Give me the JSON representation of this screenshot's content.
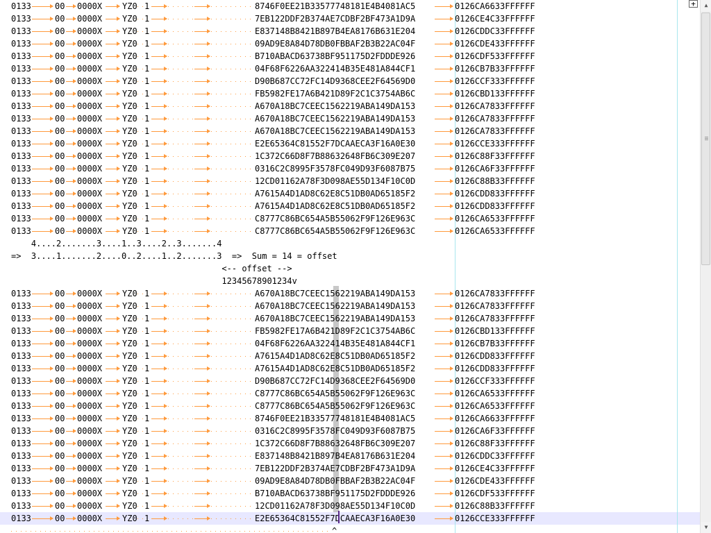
{
  "editor": {
    "prefix": {
      "c1": "0133",
      "c2": "00",
      "c3": "0000X",
      "c4": "YZ0",
      "c5": "1"
    },
    "top_rows": [
      {
        "hash": "8746F0EE21B33577748181E4B4081AC5",
        "code": "0126CA6633FFFFFF"
      },
      {
        "hash": "7EB122DDF2B374AE7CDBF2BF473A1D9A",
        "code": "0126CE4C33FFFFFF"
      },
      {
        "hash": "E837148B8421B897B4EA8176B631E204",
        "code": "0126CDDC33FFFFFF"
      },
      {
        "hash": "09AD9E8A84D78DB0FBBAF2B3B22AC04F",
        "code": "0126CDE433FFFFFF"
      },
      {
        "hash": "B710ABACD63738BF951175D2FDDDE926",
        "code": "0126CDF533FFFFFF"
      },
      {
        "hash": "04F68F6226AA322414B35E481A844CF1",
        "code": "0126CB7B33FFFFFF"
      },
      {
        "hash": "D90B687CC72FC14D9368CEE2F64569D0",
        "code": "0126CCF333FFFFFF"
      },
      {
        "hash": "FB5982FE17A6B421D89F2C1C3754AB6C",
        "code": "0126CBD133FFFFFF"
      },
      {
        "hash": "A670A18BC7CEEC1562219ABA149DA153",
        "code": "0126CA7833FFFFFF"
      },
      {
        "hash": "A670A18BC7CEEC1562219ABA149DA153",
        "code": "0126CA7833FFFFFF"
      },
      {
        "hash": "A670A18BC7CEEC1562219ABA149DA153",
        "code": "0126CA7833FFFFFF"
      },
      {
        "hash": "E2E65364C81552F7DCAAECA3F16A0E30",
        "code": "0126CCE333FFFFFF"
      },
      {
        "hash": "1C372C66D8F7B88632648FB6C309E207",
        "code": "0126C88F33FFFFFF"
      },
      {
        "hash": "0316C2C8995F3578FC049D93F6087B75",
        "code": "0126CA6F33FFFFFF"
      },
      {
        "hash": "12CD01162A78F3D098AE55D134F10C0D",
        "code": "0126C88B33FFFFFF"
      },
      {
        "hash": "A7615A4D1AD8C62E8C51DB0AD65185F2",
        "code": "0126CDD833FFFFFF"
      },
      {
        "hash": "A7615A4D1AD8C62E8C51DB0AD65185F2",
        "code": "0126CDD833FFFFFF"
      },
      {
        "hash": "C8777C86BC654A5B55062F9F126E963C",
        "code": "0126CA6533FFFFFF"
      },
      {
        "hash": "C8777C86BC654A5B55062F9F126E963C",
        "code": "0126CA6533FFFFFF"
      }
    ],
    "note_lines": [
      "    4....2.......3....1..3....2..3.......4",
      "=>  3....1.......2....0..2....1..2.......3  =>  Sum = 14 = offset",
      "                                          <-- offset -->",
      "                                          12345678901234v"
    ],
    "bottom_rows": [
      {
        "hash": "A670A18BC7CEEC1562219ABA149DA153",
        "code": "0126CA7833FFFFFF"
      },
      {
        "hash": "A670A18BC7CEEC1562219ABA149DA153",
        "code": "0126CA7833FFFFFF"
      },
      {
        "hash": "A670A18BC7CEEC1562219ABA149DA153",
        "code": "0126CA7833FFFFFF"
      },
      {
        "hash": "FB5982FE17A6B421D89F2C1C3754AB6C",
        "code": "0126CBD133FFFFFF"
      },
      {
        "hash": "04F68F6226AA322414B35E481A844CF1",
        "code": "0126CB7B33FFFFFF"
      },
      {
        "hash": "A7615A4D1AD8C62E8C51DB0AD65185F2",
        "code": "0126CDD833FFFFFF"
      },
      {
        "hash": "A7615A4D1AD8C62E8C51DB0AD65185F2",
        "code": "0126CDD833FFFFFF"
      },
      {
        "hash": "D90B687CC72FC14D9368CEE2F64569D0",
        "code": "0126CCF333FFFFFF"
      },
      {
        "hash": "C8777C86BC654A5B55062F9F126E963C",
        "code": "0126CA6533FFFFFF"
      },
      {
        "hash": "C8777C86BC654A5B55062F9F126E963C",
        "code": "0126CA6533FFFFFF"
      },
      {
        "hash": "8746F0EE21B33577748181E4B4081AC5",
        "code": "0126CA6633FFFFFF"
      },
      {
        "hash": "0316C2C8995F3578FC049D93F6087B75",
        "code": "0126CA6F33FFFFFF"
      },
      {
        "hash": "1C372C66D8F7B88632648FB6C309E207",
        "code": "0126C88F33FFFFFF"
      },
      {
        "hash": "E837148B8421B897B4EA8176B631E204",
        "code": "0126CDDC33FFFFFF"
      },
      {
        "hash": "7EB122DDF2B374AE7CDBF2BF473A1D9A",
        "code": "0126CE4C33FFFFFF"
      },
      {
        "hash": "09AD9E8A84D78DB0FBBAF2B3B22AC04F",
        "code": "0126CDE433FFFFFF"
      },
      {
        "hash": "B710ABACD63738BF951175D2FDDDE926",
        "code": "0126CDF533FFFFFF"
      },
      {
        "hash": "12CD01162A78F3D098AE55D134F10C0D",
        "code": "0126C88B33FFFFFF"
      },
      {
        "hash": "E2E65364C81552F7DCAAECA3F16A0E30",
        "code": "0126CCE333FFFFFF"
      }
    ],
    "caret_marker": "^",
    "expand_label": "+",
    "colors": {
      "whitespace": "#ff9a3c",
      "guide": "#a8e6ee",
      "current_line": "#e8e8ff",
      "column_highlight": "#c8c8c8"
    }
  },
  "scrollbar": {
    "up_icon": "triangle-up-icon",
    "down_icon": "triangle-down-icon",
    "grip_icon": "grip-lines-icon"
  }
}
